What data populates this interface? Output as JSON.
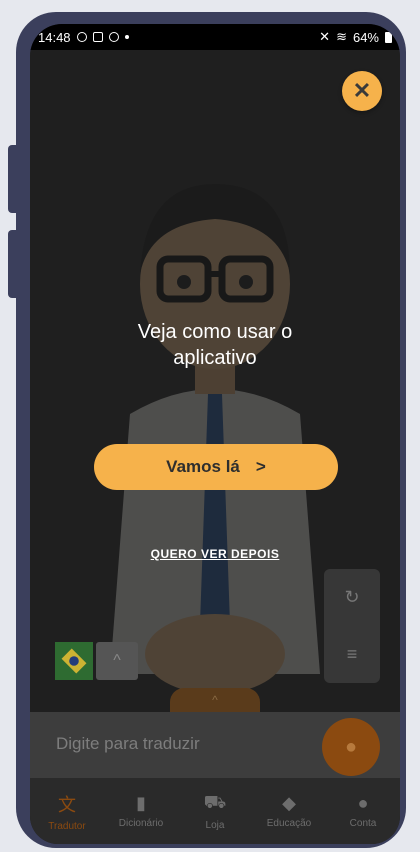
{
  "status_bar": {
    "time": "14:48",
    "battery": "64%"
  },
  "overlay": {
    "headline_line1": "Veja como usar o",
    "headline_line2": "aplicativo",
    "cta_label": "Vamos lá",
    "later_label": "QUERO VER DEPOIS"
  },
  "input": {
    "placeholder": "Digite para traduzir"
  },
  "bottom_nav": [
    {
      "label": "Tradutor",
      "icon": "translate-icon",
      "glyph": "文"
    },
    {
      "label": "Dicionário",
      "icon": "book-icon",
      "glyph": "▮"
    },
    {
      "label": "Loja",
      "icon": "cart-icon",
      "glyph": "⛟"
    },
    {
      "label": "Educação",
      "icon": "graduation-cap-icon",
      "glyph": "◆"
    },
    {
      "label": "Conta",
      "icon": "person-icon",
      "glyph": "●"
    }
  ],
  "colors": {
    "accent": "#f6b24b",
    "brand_dark": "#8b4a10"
  }
}
